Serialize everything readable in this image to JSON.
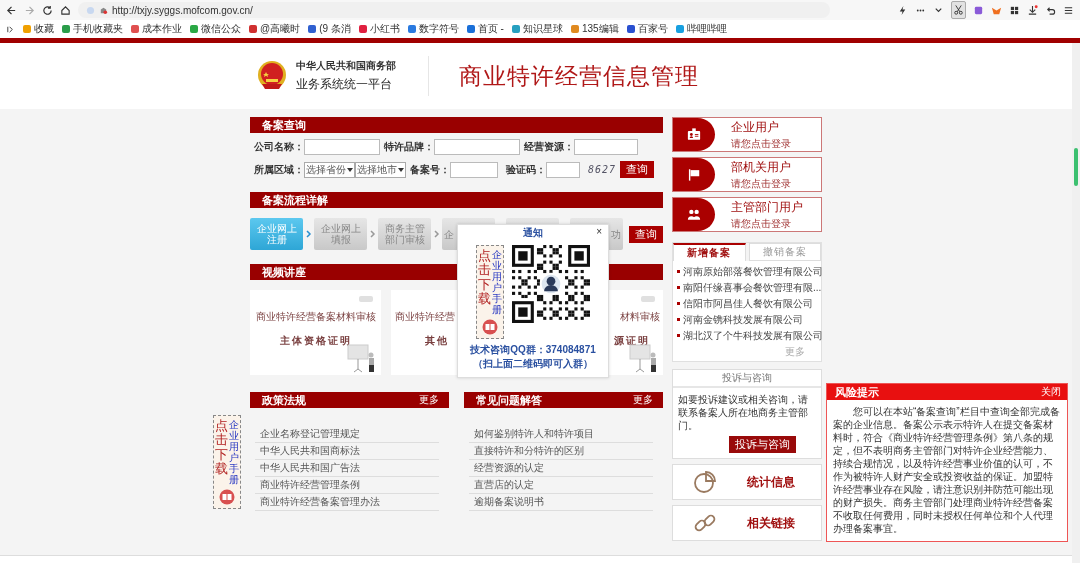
{
  "browser": {
    "url": "http://txjy.syggs.mofcom.gov.cn/",
    "bookmarks": [
      {
        "label": "收藏",
        "color": "#f0a000"
      },
      {
        "label": "手机收藏夹",
        "color": "#2a9d4a"
      },
      {
        "label": "成本作业",
        "color": "#e05050"
      },
      {
        "label": "微信公众",
        "color": "#2aa845"
      },
      {
        "label": "@高曦时",
        "color": "#d03030"
      },
      {
        "label": "(9 条消",
        "color": "#3060d0"
      },
      {
        "label": "小红书",
        "color": "#e02040"
      },
      {
        "label": "数字符号",
        "color": "#2a7ae0"
      },
      {
        "label": "首页 -",
        "color": "#1a6fd8"
      },
      {
        "label": "知识星球",
        "color": "#27a0c0"
      },
      {
        "label": "135编辑",
        "color": "#e08a20"
      },
      {
        "label": "百家号",
        "color": "#2a50d0"
      },
      {
        "label": "哔哩哔哩",
        "color": "#18a0e0"
      }
    ]
  },
  "header": {
    "ministry": "中华人民共和国商务部",
    "platform": "业务系统统一平台",
    "title": "商业特许经营信息管理"
  },
  "query": {
    "title": "备案查询",
    "fields": [
      {
        "label": "公司名称："
      },
      {
        "label": "特许品牌："
      },
      {
        "label": "经营资源："
      }
    ],
    "region_label": "所属区域：",
    "selects": [
      "选择省份",
      "选择地市"
    ],
    "record_label": "备案号：",
    "captcha_label": "验证码：",
    "captcha": "8627",
    "button": "查询"
  },
  "process": {
    "title": "备案流程详解",
    "button": "查询",
    "steps": [
      {
        "label": "企业网上注册",
        "selected": true
      },
      {
        "label": "企业网上填报",
        "selected": false
      },
      {
        "label": "商务主管部门审核",
        "selected": false
      },
      {
        "label": "企",
        "selected": false
      },
      {
        "selected": false
      },
      {
        "label": "功",
        "selected": false
      }
    ]
  },
  "videos": {
    "title": "视频讲座",
    "cards": [
      {
        "title": "商业特许经营备案材料审核",
        "subtitle": "主体资格证明"
      },
      {
        "title": "商业特许经营",
        "subtitle": "其他"
      },
      {
        "title": "材料审核",
        "subtitle": "源证明"
      }
    ]
  },
  "policies": {
    "title": "政策法规",
    "more": "更多",
    "items": [
      "企业名称登记管理规定",
      "中华人民共和国商标法",
      "中华人民共和国广告法",
      "商业特许经营管理条例",
      "商业特许经营备案管理办法"
    ]
  },
  "faq": {
    "title": "常见问题解答",
    "more": "更多",
    "items": [
      "如何鉴别特许人和特许项目",
      "直接特许和分特许的区别",
      "经营资源的认定",
      "直营店的认定",
      "逾期备案说明书"
    ]
  },
  "logins": [
    {
      "title": "企业用户",
      "subtitle": "请您点击登录",
      "kind": "card"
    },
    {
      "title": "部机关用户",
      "subtitle": "请您点击登录",
      "kind": "flag"
    },
    {
      "title": "主管部门用户",
      "subtitle": "请您点击登录",
      "kind": "people"
    }
  ],
  "records": {
    "tabs": [
      {
        "label": "新增备案",
        "selected": true
      },
      {
        "label": "撤销备案",
        "selected": false
      }
    ],
    "items": [
      "河南原始部落餐饮管理有限公司",
      "南阳仟缘喜事会餐饮管理有限...",
      "信阳市阿昌佳人餐饮有限公司",
      "河南金镌科技发展有限公司",
      "湖北汉了个牛科技发展有限公司"
    ],
    "more": "更多"
  },
  "complaint": {
    "title": "投诉与咨询",
    "text": "如要投诉建议或相关咨询，请联系备案人所在地商务主管部门。",
    "button": "投诉与咨询"
  },
  "links": [
    {
      "label": "统计信息",
      "kind": "pie"
    },
    {
      "label": "相关链接",
      "kind": "chain"
    }
  ],
  "risk": {
    "title": "风险提示",
    "close": "关闭",
    "text": "您可以在本站“备案查询”栏目中查询全部完成备案的企业信息。备案公示表示特许人在提交备案材料时，符合《商业特许经营管理条例》第八条的规定，但不表明商务主管部门对特许企业经营能力、持续合规情况，以及特许经营事业价值的认可，不作为被特许人财产安全或投资收益的保证。加盟特许经营事业存在风险，请注意识别并防范可能出现的财产损失。商务主管部门处理商业特许经营备案不收取任何费用，同时未授权任何单位和个人代理办理备案事宜。"
  },
  "popup": {
    "title": "通知",
    "close": "×",
    "manual": {
      "action": "点击下载",
      "name": "企业用户手册"
    },
    "qq": "技术咨询QQ群：374084871",
    "hint": "（扫上面二维码即可入群）"
  },
  "side_manual": {
    "action": "点击下载",
    "name": "企业用户手册"
  }
}
